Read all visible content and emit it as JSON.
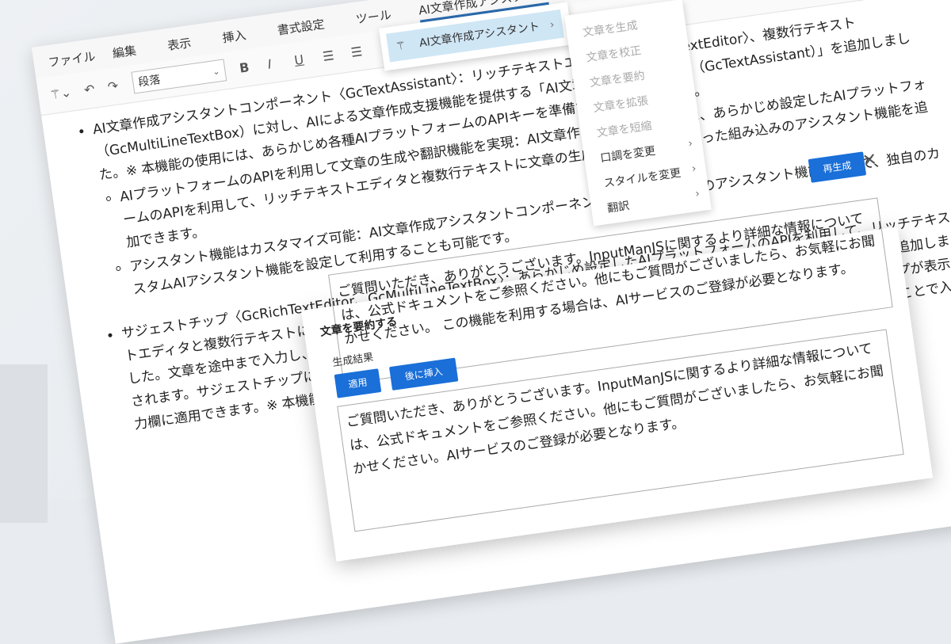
{
  "menubar": {
    "items": [
      "ファイル",
      "編集",
      "表示",
      "挿入",
      "書式設定",
      "ツール"
    ],
    "active": "AI文章作成アシスタント"
  },
  "toolbar": {
    "paragraph_select": "段落",
    "icons": [
      "ai-wand-icon",
      "undo-icon",
      "redo-icon",
      "bold-icon",
      "italic-icon",
      "underline-icon",
      "align-center-icon",
      "align-justify-icon"
    ]
  },
  "content": {
    "bullet1": "AI文章作成アシスタントコンポーネント〈GcTextAssistant〉：リッチテキストエディタ〈GcRichTextEditor〉、複数行テキスト（GcMultiLineTextBox）に対し、AIによる文章作成支援機能を提供する「AI文章作成アシスタント（GcTextAssistant）」を追加しました。※ 本機能の使用には、あらかじめ各種AIプラットフォームのAPIキーを準備する必要があります。",
    "sub1": "AIプラットフォームのAPIを利用して文章の生成や翻訳機能を実現：AI文章作成アシスタントでは、あらかじめ設定したAIプラットフォームのAPIを利用して、リッチテキストエディタと複数行テキストに文章の生成や要約、翻訳といった組み込みのアシスタント機能を追加できます。",
    "sub2": "アシスタント機能はカスタマイズ可能：AI文章作成アシスタントコンポーネントでは、組み込みのアシスタント機能に加えて、独自のカスタムAIアシスタント機能を設定して利用することも可能です。",
    "bullet2": "サジェストチップ〈GcRichTextEditor、GcMultiLineTextBox〉：あらかじめ設定したAIプラットフォームのAPIを利用して、リッチテキストエディタと複数行テキストに入力された内容に応じたサジェストをツールチップとして表示できる「サジェストチップ」機能を追加しました。文章を途中まで入力し、チップを作成するショートカットキー（デフォルトではTabキー）を押下すると、サジェストチップが表示されます。サジェストチップに表示された内容は、チップを適用するショートカットキー（デフォルトではTabキー）を押下することで入力欄に適用できます。※ 本機能の使用には、あらかじめ各種AIプラットフォームのAPIキーを準備する必要があります。"
  },
  "menu": {
    "parent": "AI文章作成アシスタント",
    "submenu": [
      {
        "label": "文章を生成",
        "enabled": false,
        "has_sub": false
      },
      {
        "label": "文章を校正",
        "enabled": false,
        "has_sub": false
      },
      {
        "label": "文章を要約",
        "enabled": false,
        "has_sub": false
      },
      {
        "label": "文章を拡張",
        "enabled": false,
        "has_sub": false
      },
      {
        "label": "文章を短縮",
        "enabled": false,
        "has_sub": false
      },
      {
        "label": "口調を変更",
        "enabled": true,
        "has_sub": true
      },
      {
        "label": "スタイルを変更",
        "enabled": true,
        "has_sub": true
      },
      {
        "label": "翻訳",
        "enabled": true,
        "has_sub": true
      }
    ]
  },
  "dialog": {
    "title": "文章を要約する",
    "result_label": "生成結果",
    "apply": "適用",
    "insert_after": "後に挿入",
    "regenerate": "再生成",
    "close": "✕",
    "original_text": "ご質問いただき、ありがとうございます。InputManJSに関するより詳細な情報については、公式ドキュメントをご参照ください。他にもご質問がございましたら、お気軽にお聞かせください。\nこの機能を利用する場合は、AIサービスのご登録が必要となります。",
    "result_text": "ご質問いただき、ありがとうございます。InputManJSに関するより詳細な情報については、公式ドキュメントをご参照ください。他にもご質問がございましたら、お気軽にお聞かせくださ",
    "result_text2": "ご質問いただき、ありがとうございます。InputManJSに関するより詳細な情報については、公式ドキュメントをご参照ください。他にもご質問がございましたら、お気軽にお聞かせください。AIサービスのご登録が必要となります。"
  }
}
